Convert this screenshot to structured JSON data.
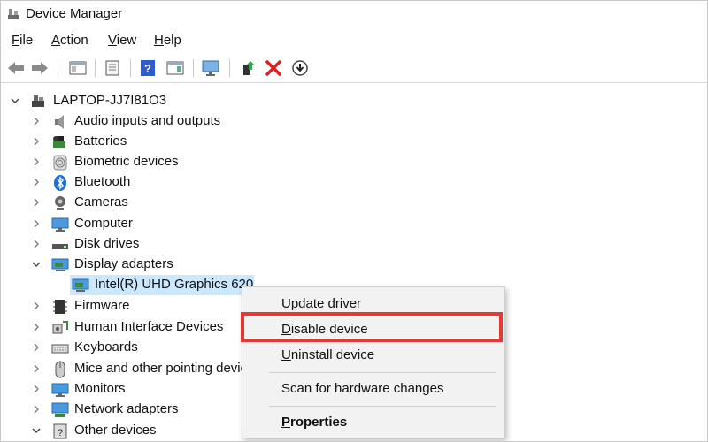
{
  "window": {
    "title": "Device Manager",
    "icon": "device-manager-icon"
  },
  "menu": {
    "file": "File",
    "action": "Action",
    "view": "View",
    "help": "Help"
  },
  "toolbar": {
    "icons": [
      "back-arrow-icon",
      "forward-arrow-icon",
      "show-hide-tree-icon",
      "properties-icon",
      "help-icon",
      "view-details-icon",
      "monitor-scan-icon",
      "update-driver-icon",
      "uninstall-x-icon",
      "disable-download-icon"
    ]
  },
  "tree": {
    "root": "LAPTOP-JJ7I81O3",
    "items": [
      {
        "label": "Audio inputs and outputs",
        "icon": "speaker-icon"
      },
      {
        "label": "Batteries",
        "icon": "battery-icon"
      },
      {
        "label": "Biometric devices",
        "icon": "fingerprint-icon"
      },
      {
        "label": "Bluetooth",
        "icon": "bluetooth-icon"
      },
      {
        "label": "Cameras",
        "icon": "camera-icon"
      },
      {
        "label": "Computer",
        "icon": "computer-icon"
      },
      {
        "label": "Disk drives",
        "icon": "disk-drive-icon"
      },
      {
        "label": "Display adapters",
        "icon": "display-adapter-icon"
      },
      {
        "label": "Intel(R) UHD Graphics 620",
        "icon": "display-adapter-icon"
      },
      {
        "label": "Firmware",
        "icon": "firmware-icon"
      },
      {
        "label": "Human Interface Devices",
        "icon": "hid-icon"
      },
      {
        "label": "Keyboards",
        "icon": "keyboard-icon"
      },
      {
        "label": "Mice and other pointing devices",
        "icon": "mouse-icon"
      },
      {
        "label": "Monitors",
        "icon": "monitor-icon"
      },
      {
        "label": "Network adapters",
        "icon": "network-adapter-icon"
      },
      {
        "label": "Other devices",
        "icon": "other-devices-icon"
      }
    ]
  },
  "context_menu": {
    "update_driver": "Update driver",
    "disable_device": "Disable device",
    "uninstall_device": "Uninstall device",
    "scan_hardware": "Scan for hardware changes",
    "properties": "Properties"
  },
  "colors": {
    "selection": "#cce8ff",
    "highlight_border": "#e53935",
    "menu_bg": "#f2f2f2"
  }
}
